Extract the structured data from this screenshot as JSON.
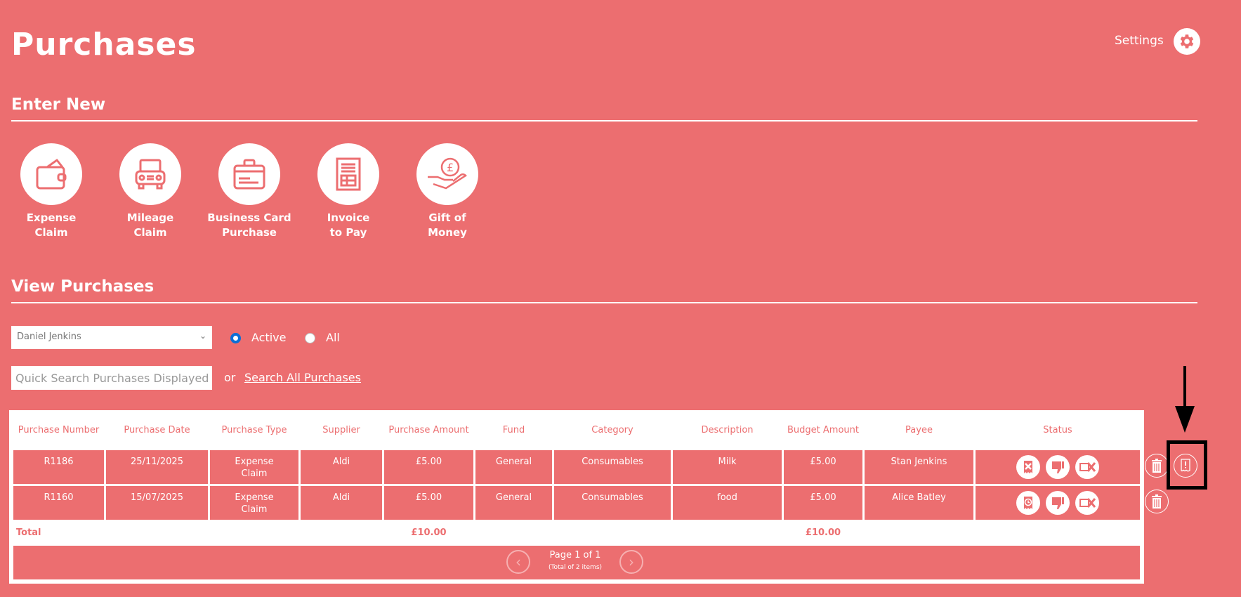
{
  "header": {
    "title": "Purchases",
    "settings_label": "Settings"
  },
  "enter_new": {
    "heading": "Enter New",
    "tiles": [
      {
        "label": "Expense\nClaim",
        "icon": "wallet-icon"
      },
      {
        "label": "Mileage\nClaim",
        "icon": "car-icon"
      },
      {
        "label": "Business Card\nPurchase",
        "icon": "briefcase-card-icon"
      },
      {
        "label": "Invoice\nto Pay",
        "icon": "invoice-icon"
      },
      {
        "label": "Gift of\nMoney",
        "icon": "hand-pound-icon"
      }
    ]
  },
  "view": {
    "heading": "View Purchases",
    "person_select": "Daniel Jenkins",
    "radio_active": "Active",
    "radio_all": "All",
    "selected_filter": "Active",
    "search_placeholder": "Quick Search Purchases Displayed",
    "or": "or",
    "search_all": "Search All Purchases"
  },
  "table": {
    "headers": [
      "Purchase Number",
      "Purchase Date",
      "Purchase Type",
      "Supplier",
      "Purchase Amount",
      "Fund",
      "Category",
      "Description",
      "Budget Amount",
      "Payee",
      "Status"
    ],
    "rows": [
      {
        "number": "R1186",
        "date": "25/11/2025",
        "type": "Expense Claim",
        "supplier": "Aldi",
        "amount": "£5.00",
        "fund": "General",
        "category": "Consumables",
        "description": "Milk",
        "budget": "£5.00",
        "payee": "Stan Jenkins",
        "status_icons": [
          "receipt-rejected-icon",
          "thumbs-down-icon",
          "card-cancel-icon"
        ]
      },
      {
        "number": "R1160",
        "date": "15/07/2025",
        "type": "Expense Claim",
        "supplier": "Aldi",
        "amount": "£5.00",
        "fund": "General",
        "category": "Consumables",
        "description": "food",
        "budget": "£5.00",
        "payee": "Alice Batley",
        "status_icons": [
          "receipt-pending-icon",
          "thumbs-down-icon",
          "card-cancel-icon"
        ]
      }
    ],
    "total_label": "Total",
    "total_amount": "£10.00",
    "total_budget": "£10.00",
    "pager": {
      "page": "Page 1 of 1",
      "total": "(Total of 2 items)"
    }
  },
  "colors": {
    "background": "#EC6E70",
    "accent": "#ffffff",
    "radio": "#0a6fd6"
  }
}
